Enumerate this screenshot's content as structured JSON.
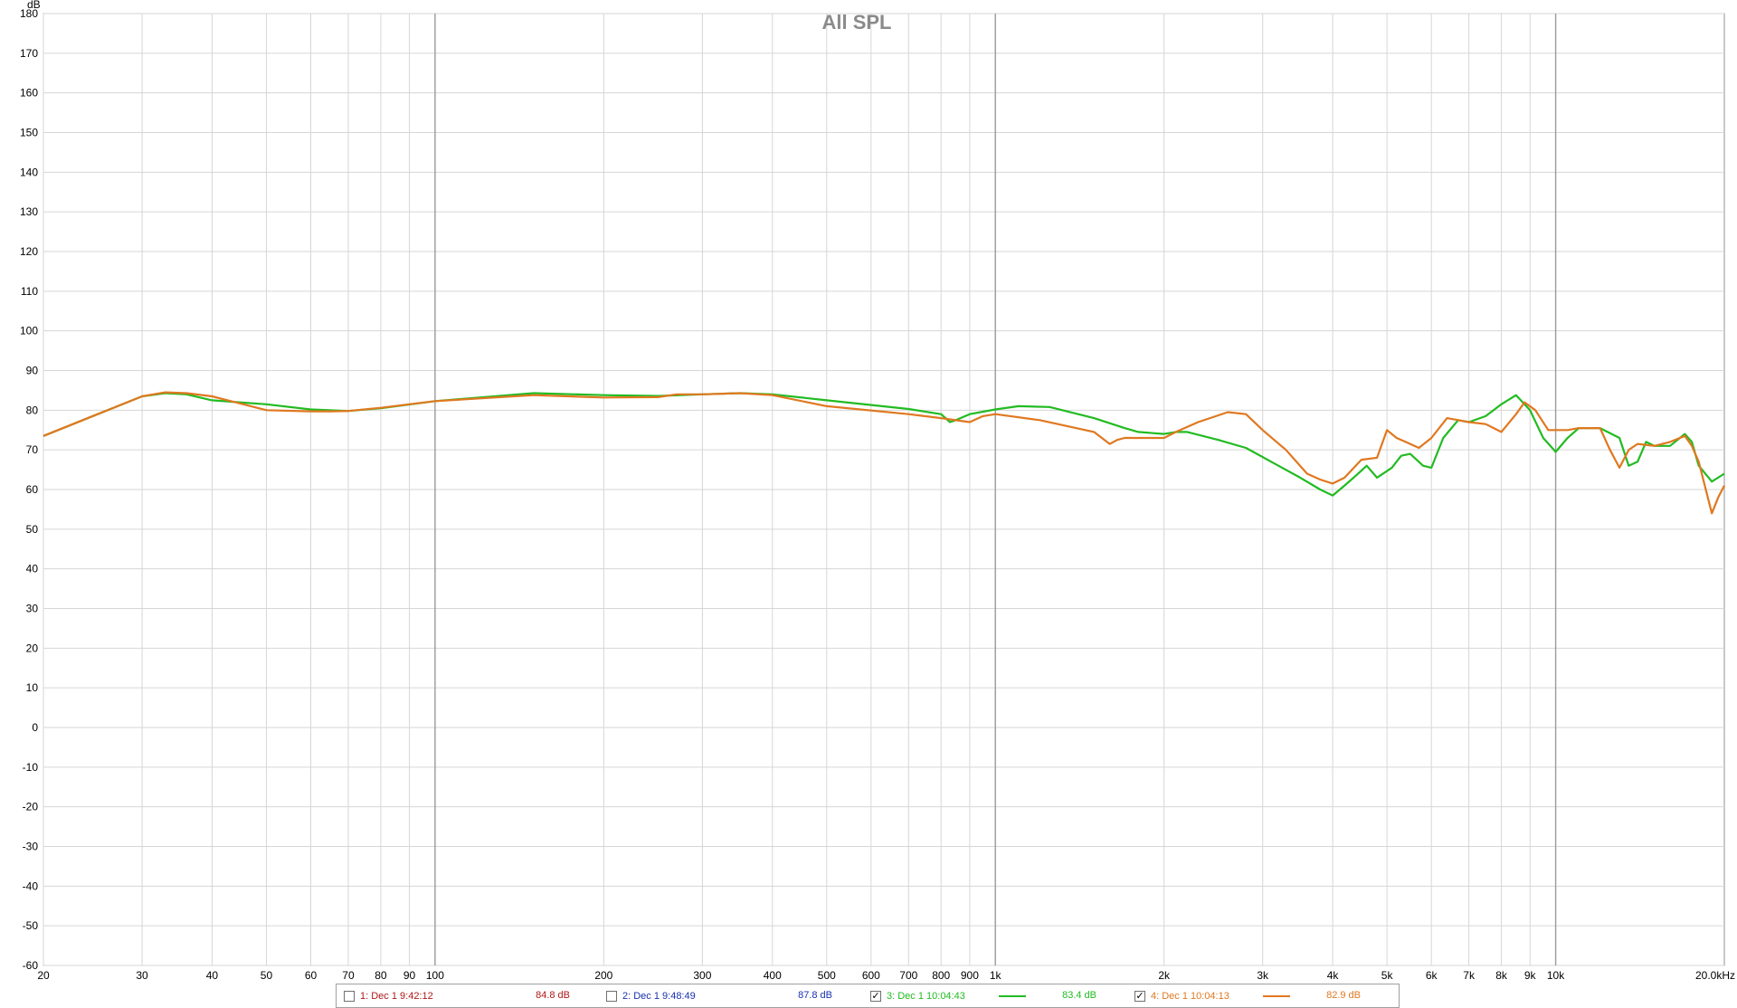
{
  "chart_data": {
    "type": "line",
    "title": "All SPL",
    "ylabel": "dB",
    "xlabel": "",
    "x_unit_label": "20.0kHz",
    "x_scale": "log",
    "xlim": [
      20,
      20000
    ],
    "ylim": [
      -60,
      180
    ],
    "grid": true,
    "y_ticks": [
      180,
      170,
      160,
      150,
      140,
      130,
      120,
      110,
      100,
      90,
      80,
      70,
      60,
      50,
      40,
      30,
      20,
      10,
      0,
      -10,
      -20,
      -30,
      -40,
      -50,
      -60
    ],
    "x_ticks": [
      {
        "value": 20,
        "label": "20"
      },
      {
        "value": 30,
        "label": "30"
      },
      {
        "value": 40,
        "label": "40"
      },
      {
        "value": 50,
        "label": "50"
      },
      {
        "value": 60,
        "label": "60"
      },
      {
        "value": 70,
        "label": "70"
      },
      {
        "value": 80,
        "label": "80"
      },
      {
        "value": 90,
        "label": "90"
      },
      {
        "value": 100,
        "label": "100"
      },
      {
        "value": 200,
        "label": "200"
      },
      {
        "value": 300,
        "label": "300"
      },
      {
        "value": 400,
        "label": "400"
      },
      {
        "value": 500,
        "label": "500"
      },
      {
        "value": 600,
        "label": "600"
      },
      {
        "value": 700,
        "label": "700"
      },
      {
        "value": 800,
        "label": "800"
      },
      {
        "value": 900,
        "label": "900"
      },
      {
        "value": 1000,
        "label": "1k"
      },
      {
        "value": 2000,
        "label": "2k"
      },
      {
        "value": 3000,
        "label": "3k"
      },
      {
        "value": 4000,
        "label": "4k"
      },
      {
        "value": 5000,
        "label": "5k"
      },
      {
        "value": 6000,
        "label": "6k"
      },
      {
        "value": 7000,
        "label": "7k"
      },
      {
        "value": 8000,
        "label": "8k"
      },
      {
        "value": 9000,
        "label": "9k"
      },
      {
        "value": 10000,
        "label": "10k"
      }
    ],
    "series": [
      {
        "name": "3: Dec 1 10:04:43",
        "color": "#22bb22",
        "points": [
          [
            20,
            73.5
          ],
          [
            25,
            79
          ],
          [
            30,
            83.5
          ],
          [
            33,
            84.3
          ],
          [
            36,
            84
          ],
          [
            40,
            82.5
          ],
          [
            50,
            81.5
          ],
          [
            60,
            80.2
          ],
          [
            70,
            79.8
          ],
          [
            80,
            80.5
          ],
          [
            100,
            82.3
          ],
          [
            150,
            84.3
          ],
          [
            200,
            83.8
          ],
          [
            250,
            83.6
          ],
          [
            300,
            84
          ],
          [
            350,
            84.3
          ],
          [
            400,
            84
          ],
          [
            500,
            82.5
          ],
          [
            700,
            80.3
          ],
          [
            800,
            79
          ],
          [
            830,
            77
          ],
          [
            850,
            77.5
          ],
          [
            900,
            79
          ],
          [
            1000,
            80.2
          ],
          [
            1100,
            81
          ],
          [
            1250,
            80.8
          ],
          [
            1500,
            78
          ],
          [
            1700,
            75.5
          ],
          [
            1800,
            74.5
          ],
          [
            2000,
            74
          ],
          [
            2100,
            74.5
          ],
          [
            2200,
            74.5
          ],
          [
            2500,
            72.5
          ],
          [
            2800,
            70.5
          ],
          [
            3200,
            66
          ],
          [
            3500,
            63
          ],
          [
            3800,
            60
          ],
          [
            4000,
            58.5
          ],
          [
            4200,
            61
          ],
          [
            4400,
            63.5
          ],
          [
            4600,
            66
          ],
          [
            4800,
            63
          ],
          [
            5100,
            65.5
          ],
          [
            5300,
            68.5
          ],
          [
            5500,
            69
          ],
          [
            5800,
            66
          ],
          [
            6000,
            65.5
          ],
          [
            6300,
            73
          ],
          [
            6700,
            77.5
          ],
          [
            7000,
            77
          ],
          [
            7500,
            78.5
          ],
          [
            8000,
            81.5
          ],
          [
            8500,
            83.8
          ],
          [
            9000,
            80
          ],
          [
            9500,
            73
          ],
          [
            10000,
            69.5
          ],
          [
            10500,
            73
          ],
          [
            11000,
            75.5
          ],
          [
            12000,
            75.5
          ],
          [
            13000,
            73
          ],
          [
            13500,
            66
          ],
          [
            14000,
            67
          ],
          [
            14500,
            72
          ],
          [
            15000,
            71
          ],
          [
            16000,
            71
          ],
          [
            17000,
            74
          ],
          [
            17500,
            72
          ],
          [
            18000,
            66
          ],
          [
            19000,
            62
          ],
          [
            20000,
            64
          ]
        ]
      },
      {
        "name": "4: Dec 1 10:04:13",
        "color": "#e07820",
        "points": [
          [
            20,
            73.5
          ],
          [
            25,
            79
          ],
          [
            30,
            83.5
          ],
          [
            33,
            84.5
          ],
          [
            36,
            84.3
          ],
          [
            40,
            83.5
          ],
          [
            50,
            80
          ],
          [
            60,
            79.7
          ],
          [
            65,
            79.7
          ],
          [
            70,
            79.8
          ],
          [
            80,
            80.6
          ],
          [
            100,
            82.3
          ],
          [
            150,
            83.8
          ],
          [
            200,
            83.2
          ],
          [
            250,
            83.3
          ],
          [
            270,
            84
          ],
          [
            300,
            84
          ],
          [
            350,
            84.3
          ],
          [
            400,
            83.8
          ],
          [
            500,
            81
          ],
          [
            700,
            79
          ],
          [
            800,
            78
          ],
          [
            900,
            77
          ],
          [
            950,
            78.5
          ],
          [
            1000,
            79
          ],
          [
            1200,
            77.5
          ],
          [
            1500,
            74.5
          ],
          [
            1600,
            71.5
          ],
          [
            1650,
            72.5
          ],
          [
            1700,
            73
          ],
          [
            2000,
            73
          ],
          [
            2100,
            74.5
          ],
          [
            2300,
            77
          ],
          [
            2600,
            79.5
          ],
          [
            2800,
            79
          ],
          [
            3000,
            75
          ],
          [
            3300,
            70
          ],
          [
            3600,
            64
          ],
          [
            3800,
            62.5
          ],
          [
            4000,
            61.5
          ],
          [
            4200,
            63
          ],
          [
            4500,
            67.5
          ],
          [
            4800,
            68
          ],
          [
            5000,
            75
          ],
          [
            5200,
            73
          ],
          [
            5400,
            72
          ],
          [
            5700,
            70.5
          ],
          [
            6000,
            73
          ],
          [
            6400,
            78
          ],
          [
            6700,
            77.5
          ],
          [
            7000,
            77
          ],
          [
            7500,
            76.5
          ],
          [
            8000,
            74.5
          ],
          [
            8500,
            79
          ],
          [
            8800,
            82
          ],
          [
            9200,
            80
          ],
          [
            9700,
            75
          ],
          [
            10500,
            75
          ],
          [
            11000,
            75.5
          ],
          [
            12000,
            75.5
          ],
          [
            12500,
            70
          ],
          [
            13000,
            65.5
          ],
          [
            13500,
            70
          ],
          [
            14000,
            71.5
          ],
          [
            15000,
            71
          ],
          [
            16000,
            72
          ],
          [
            17000,
            73.5
          ],
          [
            17500,
            71
          ],
          [
            18000,
            67
          ],
          [
            19000,
            54
          ],
          [
            19500,
            58
          ],
          [
            20000,
            61
          ]
        ]
      }
    ]
  },
  "legend": [
    {
      "checked": false,
      "check_glyph": "",
      "label": "1: Dec 1 9:42:12",
      "value": "84.8 dB",
      "color": "#b01818",
      "swatch": false
    },
    {
      "checked": false,
      "check_glyph": "",
      "label": "2: Dec 1 9:48:49",
      "value": "87.8 dB",
      "color": "#1830b0",
      "swatch": false
    },
    {
      "checked": true,
      "check_glyph": "✓",
      "label": "3: Dec 1 10:04:43",
      "value": "83.4 dB",
      "color": "#22bb22",
      "swatch": true
    },
    {
      "checked": true,
      "check_glyph": "✓",
      "label": "4: Dec 1 10:04:13",
      "value": "82.9 dB",
      "color": "#e07820",
      "swatch": true
    }
  ]
}
